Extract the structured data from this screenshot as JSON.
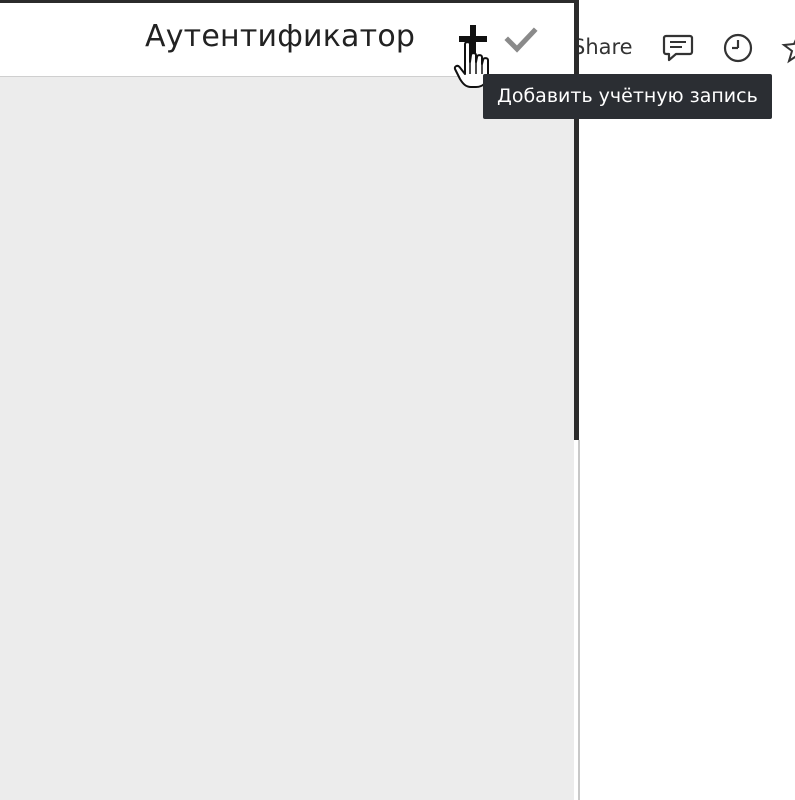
{
  "popup": {
    "title": "Аутентификатор",
    "add_button_icon": "plus-icon",
    "check_button_icon": "checkmark-icon",
    "tooltip": "Добавить учётную запись"
  },
  "background_page": {
    "share_label": "Share",
    "icons": [
      "comment-icon",
      "history-icon",
      "star-icon"
    ]
  },
  "colors": {
    "popup_body": "#ececec",
    "header": "#ffffff",
    "tooltip_bg": "#2b2e33",
    "tooltip_text": "#ffffff",
    "check_icon": "#8a8a8a"
  }
}
